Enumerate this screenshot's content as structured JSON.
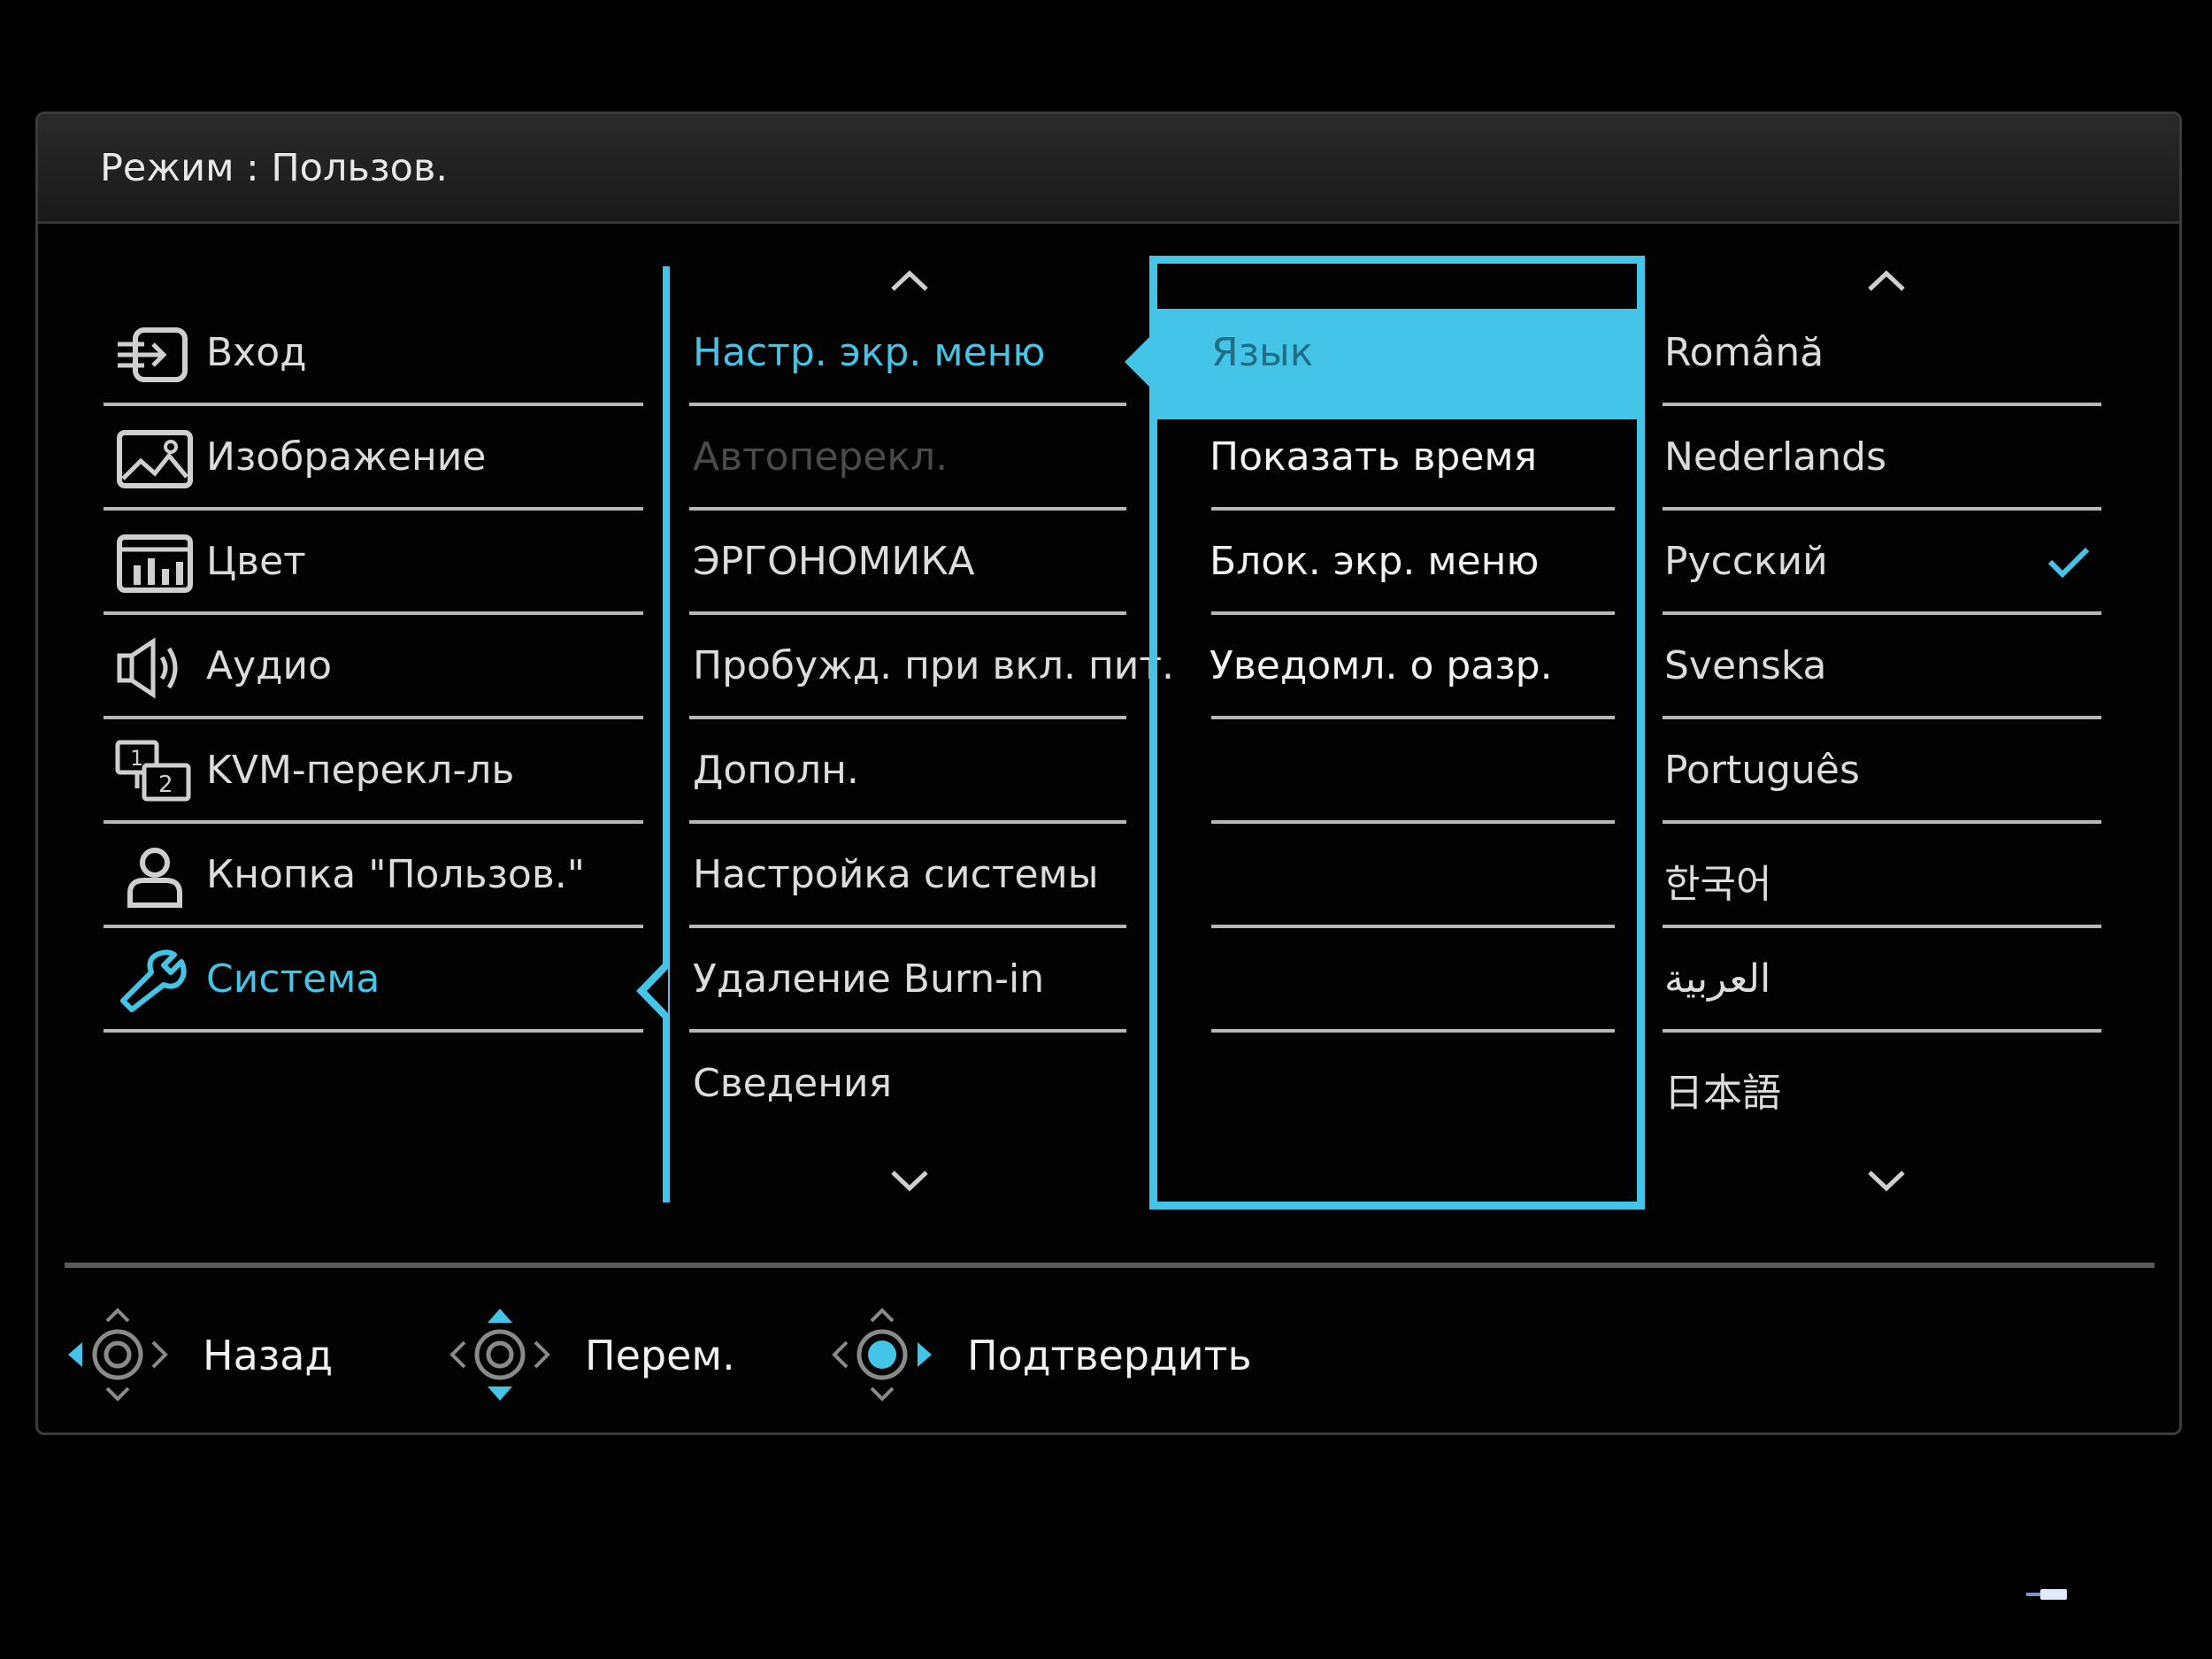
{
  "header": {
    "title": "Режим : Пользов."
  },
  "main_menu": [
    {
      "label": "Вход",
      "icon": "input-icon",
      "selected": false
    },
    {
      "label": "Изображение",
      "icon": "picture-icon",
      "selected": false
    },
    {
      "label": "Цвет",
      "icon": "color-icon",
      "selected": false
    },
    {
      "label": "Аудио",
      "icon": "speaker-icon",
      "selected": false
    },
    {
      "label": "KVM-перекл-ль",
      "icon": "kvm-icon",
      "selected": false
    },
    {
      "label": "Кнопка \"Пользов.\"",
      "icon": "user-icon",
      "selected": false
    },
    {
      "label": "Система",
      "icon": "wrench-icon",
      "selected": true
    }
  ],
  "submenu": [
    {
      "label": "Настр. экр. меню",
      "state": "selected"
    },
    {
      "label": "Автоперекл.",
      "state": "disabled"
    },
    {
      "label": "ЭРГОНОМИКА",
      "state": "normal"
    },
    {
      "label": "Пробужд. при вкл. пит.",
      "state": "normal"
    },
    {
      "label": "Дополн.",
      "state": "normal"
    },
    {
      "label": "Настройка системы",
      "state": "normal"
    },
    {
      "label": "Удаление Burn-in",
      "state": "normal"
    },
    {
      "label": "Сведения",
      "state": "normal"
    }
  ],
  "options": [
    {
      "label": "Язык",
      "state": "highlighted"
    },
    {
      "label": "Показать время",
      "state": "normal"
    },
    {
      "label": "Блок. экр. меню",
      "state": "normal"
    },
    {
      "label": "Уведомл. о разр.",
      "state": "normal"
    }
  ],
  "languages": [
    {
      "label": "Română",
      "checked": false
    },
    {
      "label": "Nederlands",
      "checked": false
    },
    {
      "label": "Русский",
      "checked": true
    },
    {
      "label": "Svenska",
      "checked": false
    },
    {
      "label": "Português",
      "checked": false
    },
    {
      "label": "한국어",
      "checked": false
    },
    {
      "label": "العربية",
      "checked": false
    },
    {
      "label": "日本語",
      "checked": false
    }
  ],
  "footer": {
    "back_label": "Назад",
    "move_label": "Перем.",
    "confirm_label": "Подтвердить"
  },
  "colors": {
    "accent": "#44c4e6",
    "text": "#dcdcdc",
    "disabled": "#4a4a4a",
    "background": "#000000"
  }
}
